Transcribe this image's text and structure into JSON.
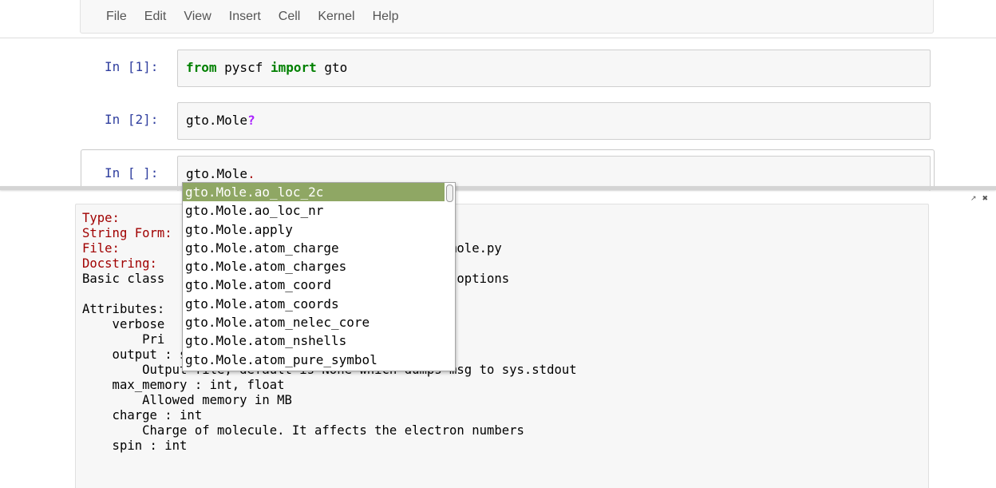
{
  "menu": [
    "File",
    "Edit",
    "View",
    "Insert",
    "Cell",
    "Kernel",
    "Help"
  ],
  "cells": [
    {
      "prompt": "In [1]:",
      "code": {
        "kw1": "from",
        "plain1": " pyscf ",
        "kw2": "import",
        "plain2": " gto"
      }
    },
    {
      "prompt": "In [2]:",
      "code": {
        "plain": "gto.Mole",
        "op": "?"
      }
    },
    {
      "prompt": "In [ ]:",
      "code": {
        "plain": "gto.Mole",
        "op": "."
      }
    }
  ],
  "pager": {
    "controls": {
      "expand_icon": "↗",
      "close_icon": "✖"
    },
    "lines": [
      {
        "label": "Type:",
        "rest": ""
      },
      {
        "label": "String Form:",
        "rest": ""
      },
      {
        "label": "File:",
        "rest": "                                   yscf/gto/mole.py"
      },
      {
        "label": "Docstring:",
        "rest": ""
      },
      {
        "label": "",
        "rest": "Basic class                                global options"
      },
      {
        "label": "",
        "rest": ""
      },
      {
        "label": "",
        "rest": "Attributes:"
      },
      {
        "label": "",
        "rest": "    verbose"
      },
      {
        "label": "",
        "rest": "        Pri"
      },
      {
        "label": "",
        "rest": "    output : str or None"
      },
      {
        "label": "",
        "rest": "        Output file, default is None which dumps msg to sys.stdout"
      },
      {
        "label": "",
        "rest": "    max_memory : int, float"
      },
      {
        "label": "",
        "rest": "        Allowed memory in MB"
      },
      {
        "label": "",
        "rest": "    charge : int"
      },
      {
        "label": "",
        "rest": "        Charge of molecule. It affects the electron numbers"
      },
      {
        "label": "",
        "rest": "    spin : int"
      }
    ]
  },
  "completer": {
    "items": [
      "gto.Mole.ao_loc_2c",
      "gto.Mole.ao_loc_nr",
      "gto.Mole.apply",
      "gto.Mole.atom_charge",
      "gto.Mole.atom_charges",
      "gto.Mole.atom_coord",
      "gto.Mole.atom_coords",
      "gto.Mole.atom_nelec_core",
      "gto.Mole.atom_nshells",
      "gto.Mole.atom_pure_symbol"
    ],
    "selected_index": 0,
    "highlight_color": "#8fa764"
  }
}
